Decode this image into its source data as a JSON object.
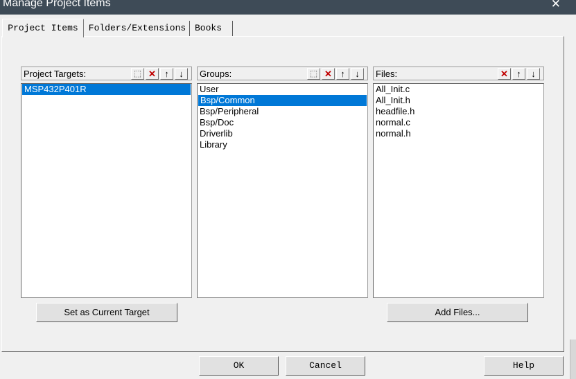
{
  "window": {
    "title": "Manage Project Items",
    "close_icon": "close-icon"
  },
  "tabs": [
    {
      "label": "Project Items",
      "active": true
    },
    {
      "label": "Folders/Extensions",
      "active": false
    },
    {
      "label": "Books",
      "active": false
    }
  ],
  "targets": {
    "header": "Project Targets:",
    "items": [
      "MSP432P401R"
    ],
    "selected_index": 0,
    "buttons": [
      "new-icon",
      "delete-icon",
      "move-up-icon",
      "move-down-icon"
    ],
    "action_label": "Set as Current Target"
  },
  "groups": {
    "header": "Groups:",
    "items": [
      "User",
      "Bsp/Common",
      "Bsp/Peripheral",
      "Bsp/Doc",
      "Driverlib",
      "Library"
    ],
    "selected_index": 1,
    "buttons": [
      "new-icon",
      "delete-icon",
      "move-up-icon",
      "move-down-icon"
    ]
  },
  "files": {
    "header": "Files:",
    "items": [
      "All_Init.c",
      "All_Init.h",
      "headfile.h",
      "normal.c",
      "normal.h"
    ],
    "buttons": [
      "delete-icon",
      "move-up-icon",
      "move-down-icon"
    ],
    "action_label": "Add Files..."
  },
  "footer": {
    "ok_label": "OK",
    "cancel_label": "Cancel",
    "help_label": "Help"
  },
  "colors": {
    "titlebar": "#3e4b57",
    "selection": "#0078d7",
    "delete": "#c00000"
  }
}
